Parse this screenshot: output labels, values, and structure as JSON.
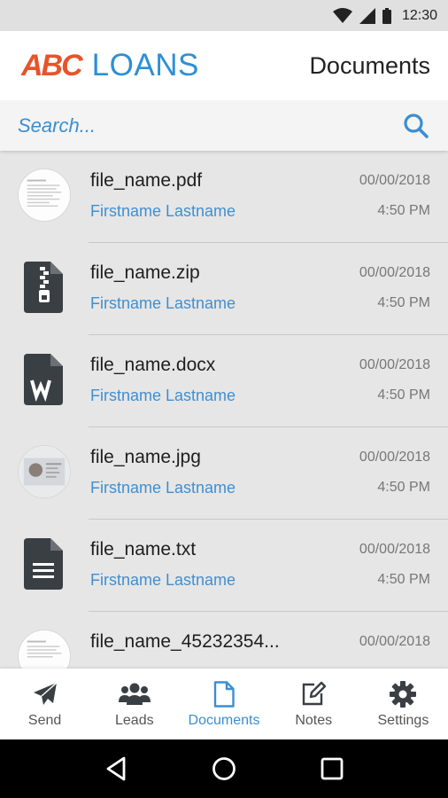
{
  "status_bar": {
    "time": "12:30"
  },
  "header": {
    "logo_abc": "ABC",
    "logo_loans": "LOANS",
    "title": "Documents"
  },
  "search": {
    "placeholder": "Search..."
  },
  "files": [
    {
      "name": "file_name.pdf",
      "owner": "Firstname Lastname",
      "date": "00/00/2018",
      "time": "4:50 PM",
      "icon": "pdf-thumbnail"
    },
    {
      "name": "file_name.zip",
      "owner": "Firstname Lastname",
      "date": "00/00/2018",
      "time": "4:50 PM",
      "icon": "zip-file-icon"
    },
    {
      "name": "file_name.docx",
      "owner": "Firstname Lastname",
      "date": "00/00/2018",
      "time": "4:50 PM",
      "icon": "word-file-icon"
    },
    {
      "name": "file_name.jpg",
      "owner": "Firstname Lastname",
      "date": "00/00/2018",
      "time": "4:50 PM",
      "icon": "image-thumbnail"
    },
    {
      "name": "file_name.txt",
      "owner": "Firstname Lastname",
      "date": "00/00/2018",
      "time": "4:50 PM",
      "icon": "text-file-icon"
    },
    {
      "name": "file_name_45232354...",
      "owner": "",
      "date": "00/00/2018",
      "time": "",
      "icon": "document-thumbnail"
    }
  ],
  "bottom_nav": [
    {
      "label": "Send",
      "icon": "send-icon"
    },
    {
      "label": "Leads",
      "icon": "users-icon"
    },
    {
      "label": "Documents",
      "icon": "document-icon",
      "active": true
    },
    {
      "label": "Notes",
      "icon": "edit-icon"
    },
    {
      "label": "Settings",
      "icon": "gear-icon"
    }
  ],
  "colors": {
    "accent": "#3b8ed2",
    "brand_orange": "#e8532a",
    "brand_blue": "#2e8fd6"
  }
}
